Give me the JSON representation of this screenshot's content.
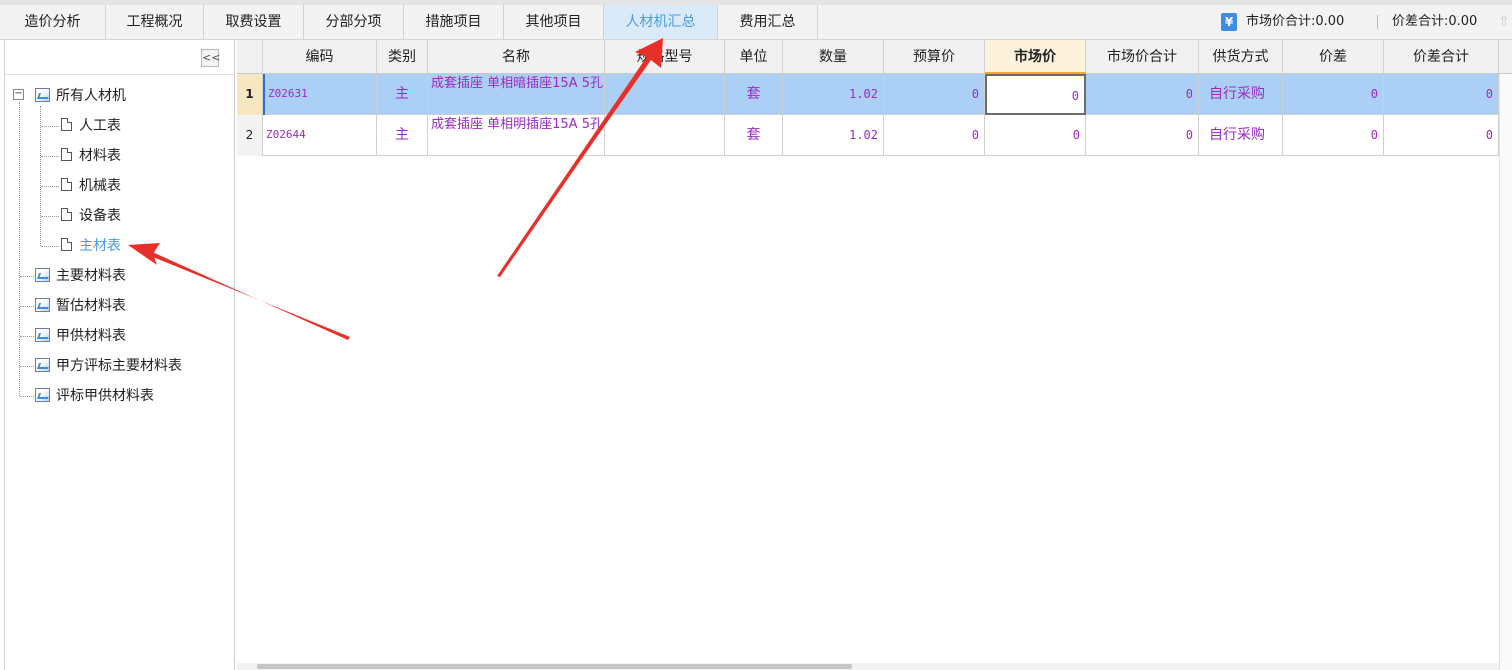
{
  "tabs": [
    {
      "label": "造价分析"
    },
    {
      "label": "工程概况"
    },
    {
      "label": "取费设置"
    },
    {
      "label": "分部分项"
    },
    {
      "label": "措施项目"
    },
    {
      "label": "其他项目"
    },
    {
      "label": "人材机汇总",
      "active": true
    },
    {
      "label": "费用汇总"
    }
  ],
  "summary": {
    "market_total": "市场价合计:0.00",
    "diff_total": "价差合计:0.00"
  },
  "sidebar": {
    "collapse_label": "<<",
    "expander_label": "−",
    "root": "所有人材机",
    "children": [
      "人工表",
      "材料表",
      "机械表",
      "设备表",
      "主材表"
    ],
    "selected": "主材表",
    "others": [
      "主要材料表",
      "暂估材料表",
      "甲供材料表",
      "甲方评标主要材料表",
      "评标甲供材料表"
    ]
  },
  "grid": {
    "columns": [
      "编码",
      "类别",
      "名称",
      "规格型号",
      "单位",
      "数量",
      "预算价",
      "市场价",
      "市场价合计",
      "供货方式",
      "价差",
      "价差合计"
    ],
    "highlight_column": "市场价",
    "rows": [
      {
        "num": "1",
        "code": "Z02631",
        "category": "主",
        "name": "成套插座 单相暗插座15A 5孔",
        "spec": "",
        "unit": "套",
        "qty": "1.02",
        "budget": "0",
        "market": "0",
        "market_total": "0",
        "supply": "自行采购",
        "diff": "0",
        "diff_total": "0"
      },
      {
        "num": "2",
        "code": "Z02644",
        "category": "主",
        "name": "成套插座 单相明插座15A 5孔",
        "spec": "",
        "unit": "套",
        "qty": "1.02",
        "budget": "0",
        "market": "0",
        "market_total": "0",
        "supply": "自行采购",
        "diff": "0",
        "diff_total": "0"
      }
    ]
  },
  "colors": {
    "accent": "#4a9be0",
    "selected_row": "#acd0f5",
    "data_text": "#9b2bc6",
    "arrow": "#e8302a"
  },
  "icons": {
    "summary": "yen-icon",
    "tree_folder": "report-icon",
    "tree_leaf": "page-icon"
  }
}
